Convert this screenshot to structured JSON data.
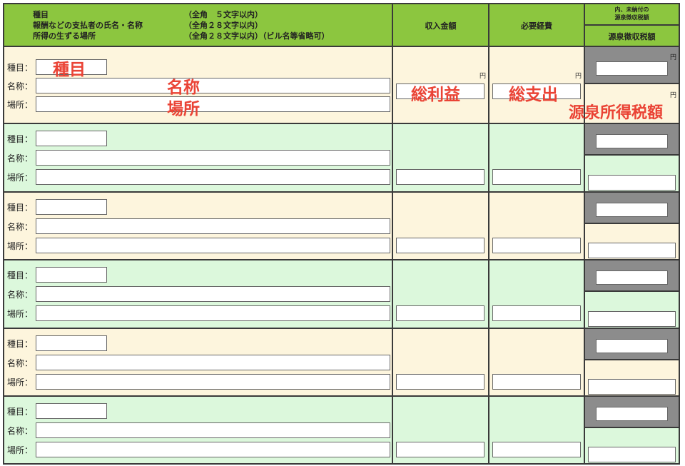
{
  "header": {
    "line1": "種目",
    "line2": "報酬などの支払者の氏名・名称",
    "line3": "所得の生ずる場所",
    "line1_note": "（全角　５文字以内）",
    "line2_note": "（全角２８文字以内）",
    "line3_note": "（全角２８文字以内）（ビル名等省略可）",
    "income": "収入金額",
    "expenses": "必要経費",
    "tax_top": "内、未納付の\n源泉徴収税額",
    "tax_bottom": "源泉徴収税額"
  },
  "labels": {
    "kind": "種目：",
    "name": "名称：",
    "place": "場所："
  },
  "yen": "円",
  "overlays": {
    "kind": "種目",
    "name": "名称",
    "place": "場所",
    "income": "総利益",
    "expenses": "総支出",
    "tax": "源泉所得税額"
  },
  "colors": {
    "header_green": "#8cc63f",
    "row_beige": "#fdf5dd",
    "row_green": "#dcf8dc",
    "gray_cell": "#8c8c8c",
    "overlay_red": "#ea4335"
  },
  "rows": [
    {
      "kind": "",
      "name": "",
      "place": "",
      "income": "",
      "expenses": "",
      "unpaid_tax": "",
      "withholding_tax": ""
    },
    {
      "kind": "",
      "name": "",
      "place": "",
      "income": "",
      "expenses": "",
      "unpaid_tax": "",
      "withholding_tax": ""
    },
    {
      "kind": "",
      "name": "",
      "place": "",
      "income": "",
      "expenses": "",
      "unpaid_tax": "",
      "withholding_tax": ""
    },
    {
      "kind": "",
      "name": "",
      "place": "",
      "income": "",
      "expenses": "",
      "unpaid_tax": "",
      "withholding_tax": ""
    },
    {
      "kind": "",
      "name": "",
      "place": "",
      "income": "",
      "expenses": "",
      "unpaid_tax": "",
      "withholding_tax": ""
    },
    {
      "kind": "",
      "name": "",
      "place": "",
      "income": "",
      "expenses": "",
      "unpaid_tax": "",
      "withholding_tax": ""
    }
  ]
}
